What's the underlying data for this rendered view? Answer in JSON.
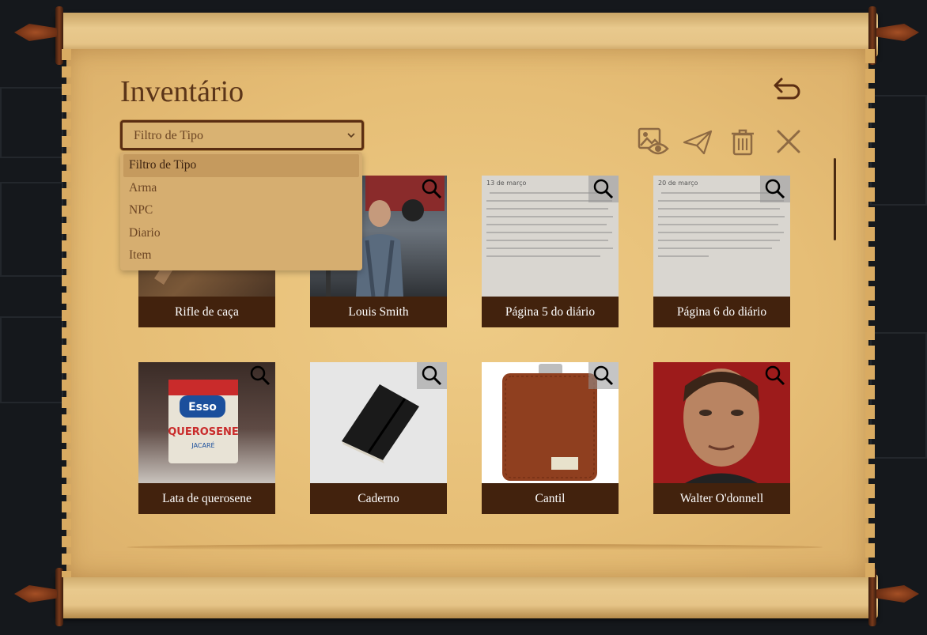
{
  "app": {
    "title": "Inventário"
  },
  "filter": {
    "selected": "Filtro de Tipo",
    "options": [
      "Filtro de Tipo",
      "Arma",
      "NPC",
      "Diario",
      "Item"
    ]
  },
  "toolbar": {
    "icons": [
      "image-view-icon",
      "send-icon",
      "trash-icon",
      "close-icon"
    ]
  },
  "items": [
    {
      "label": "Rifle de caça"
    },
    {
      "label": "Louis Smith"
    },
    {
      "label": "Página 5 do diário",
      "note": "13 de março"
    },
    {
      "label": "Página 6 do diário",
      "note": "20 de março"
    },
    {
      "label": "Lata de querosene",
      "brand": "Esso",
      "product": "QUEROSENE",
      "sub": "JACARÉ"
    },
    {
      "label": "Caderno"
    },
    {
      "label": "Cantil"
    },
    {
      "label": "Walter O'donnell"
    }
  ],
  "colors": {
    "parchment": "#e6be76",
    "ink": "#5b3519",
    "card_label_bg": "#42220d",
    "select_border": "#5a2d12"
  }
}
